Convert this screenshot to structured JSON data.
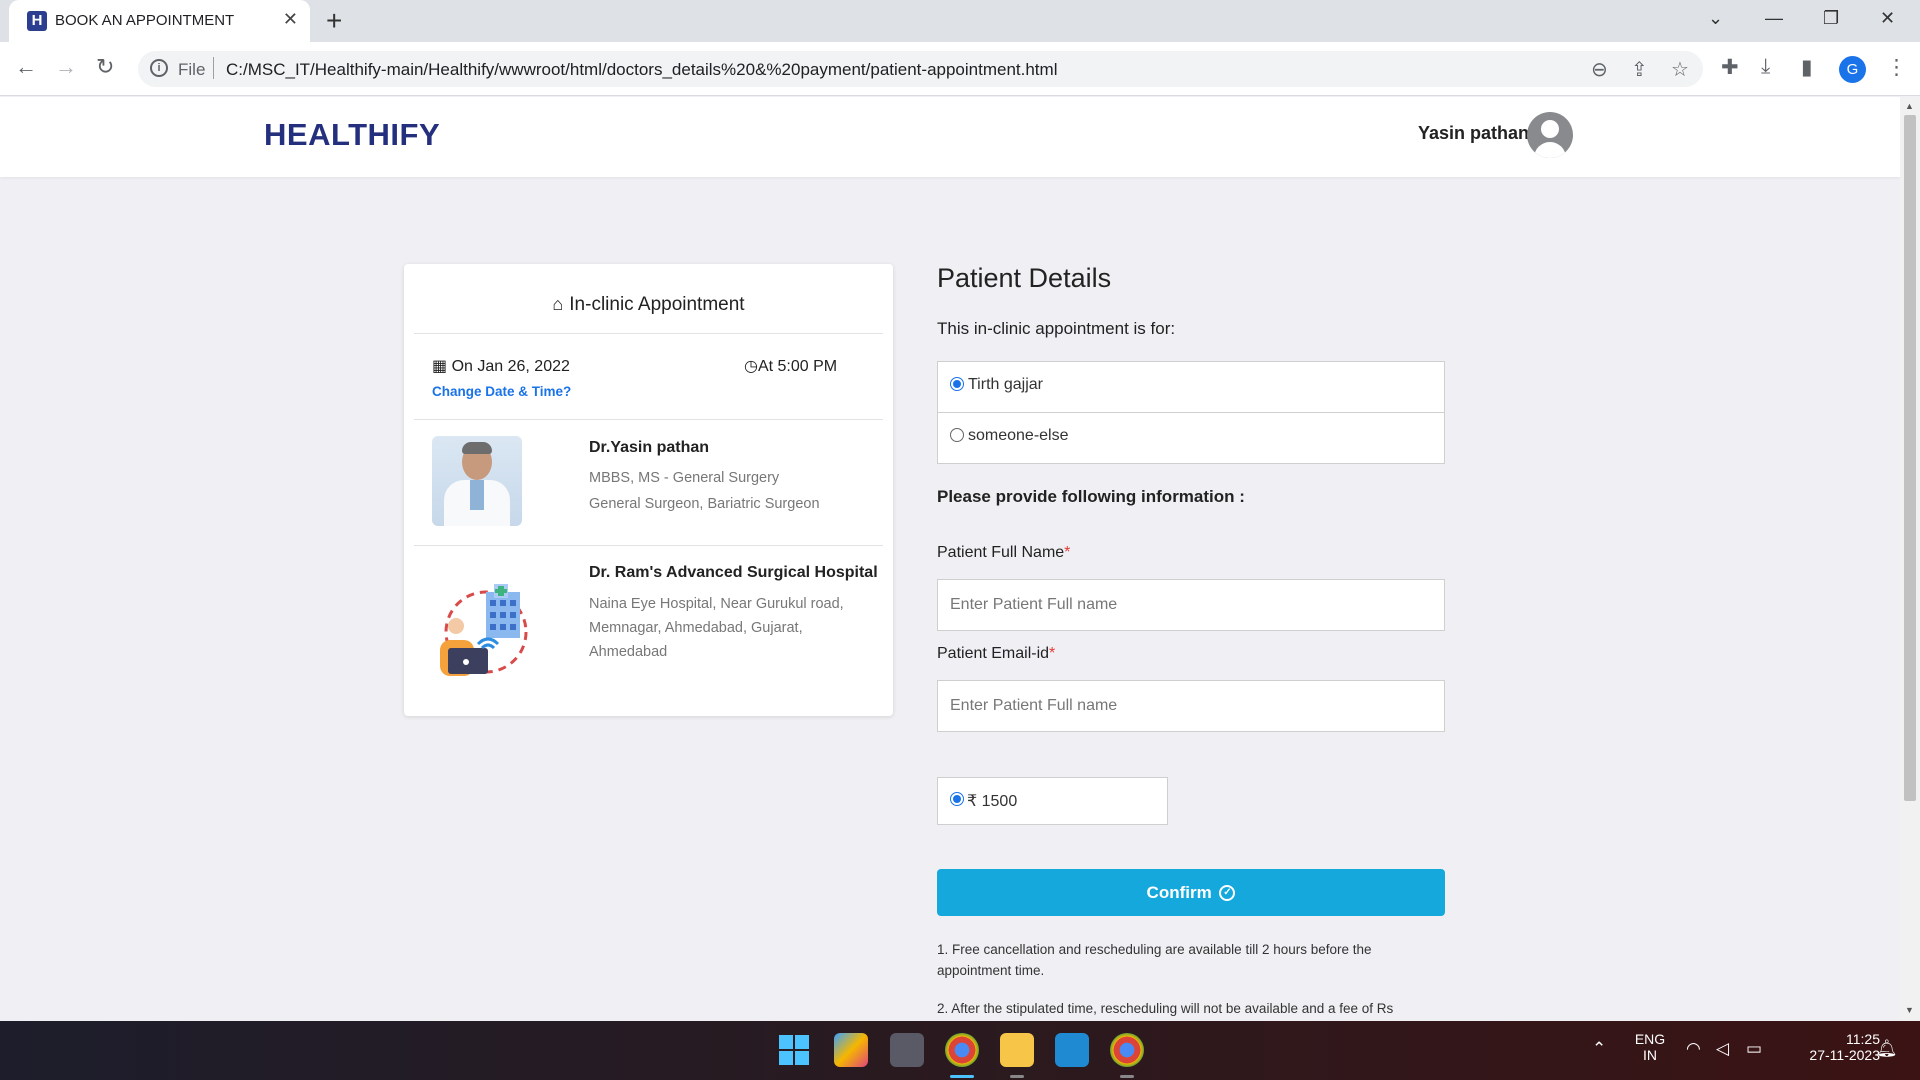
{
  "browser": {
    "tab_title": "BOOK AN APPOINTMENT",
    "tab_favicon": "H",
    "omnibox_scheme": "File",
    "url": "C:/MSC_IT/Healthify-main/Healthify/wwwroot/html/doctors_details%20&%20payment/patient-appointment.html",
    "profile_initial": "G"
  },
  "header": {
    "brand": "HEALTHIFY",
    "user_name": "Yasin pathan"
  },
  "appointment": {
    "title": "In-clinic Appointment",
    "date": "On Jan 26, 2022",
    "time": "At 5:00 PM",
    "change_link": "Change Date & Time?",
    "doctor": {
      "name": "Dr.Yasin pathan",
      "degree": "MBBS, MS - General Surgery",
      "specialty": "General Surgeon, Bariatric Surgeon"
    },
    "hospital": {
      "name": "Dr. Ram's Advanced Surgical Hospital",
      "address": "Naina Eye Hospital, Near Gurukul road, Memnagar, Ahmedabad, Gujarat, Ahmedabad"
    }
  },
  "patient": {
    "title": "Patient Details",
    "for_label": "This in-clinic appointment is for:",
    "options": [
      {
        "label": "Tirth gajjar",
        "selected": true
      },
      {
        "label": "someone-else",
        "selected": false
      }
    ],
    "info_label": "Please provide following information :",
    "name_label": "Patient Full Name",
    "name_placeholder": "Enter Patient Full name",
    "email_label": "Patient Email-id",
    "email_placeholder": "Enter Patient Full name",
    "required_mark": "*",
    "fee": "₹ 1500",
    "confirm_label": "Confirm",
    "notes": [
      "1. Free cancellation and rescheduling are available till 2 hours before the appointment time.",
      "2. After the stipulated time, rescheduling will not be available and a fee of Rs"
    ]
  },
  "taskbar": {
    "lang_line1": "ENG",
    "lang_line2": "IN",
    "time": "11:25",
    "date": "27-11-2023"
  },
  "colors": {
    "brand": "#24307d",
    "accent": "#14a8dc",
    "link": "#1a73e8",
    "required": "#e53935"
  }
}
